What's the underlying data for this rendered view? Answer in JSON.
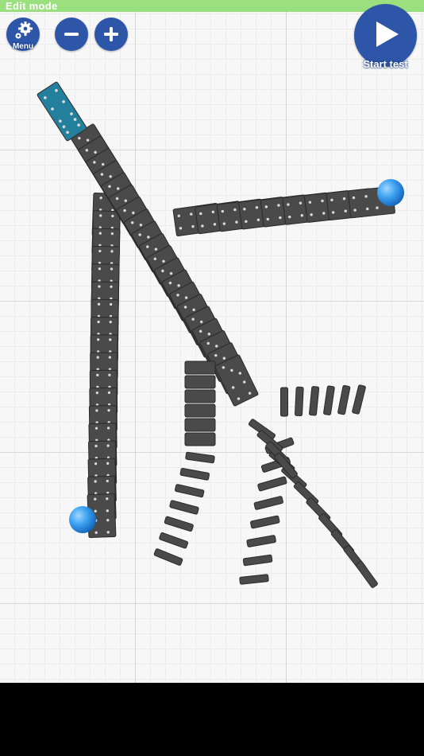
{
  "header": {
    "mode_label": "Edit mode",
    "bar_color": "#9be07f"
  },
  "toolbar": {
    "menu_label": "Menu",
    "menu_icon": "gear-icon",
    "zoom_out_icon": "minus-icon",
    "zoom_in_icon": "plus-icon",
    "start_label": "Start test",
    "start_icon": "play-icon",
    "button_color": "#2e56a8"
  },
  "colors": {
    "domino": "#4a4a4a",
    "domino_selected": "#23809c",
    "pip": "#d9d9d9",
    "ball": "#3aa0f0"
  }
}
